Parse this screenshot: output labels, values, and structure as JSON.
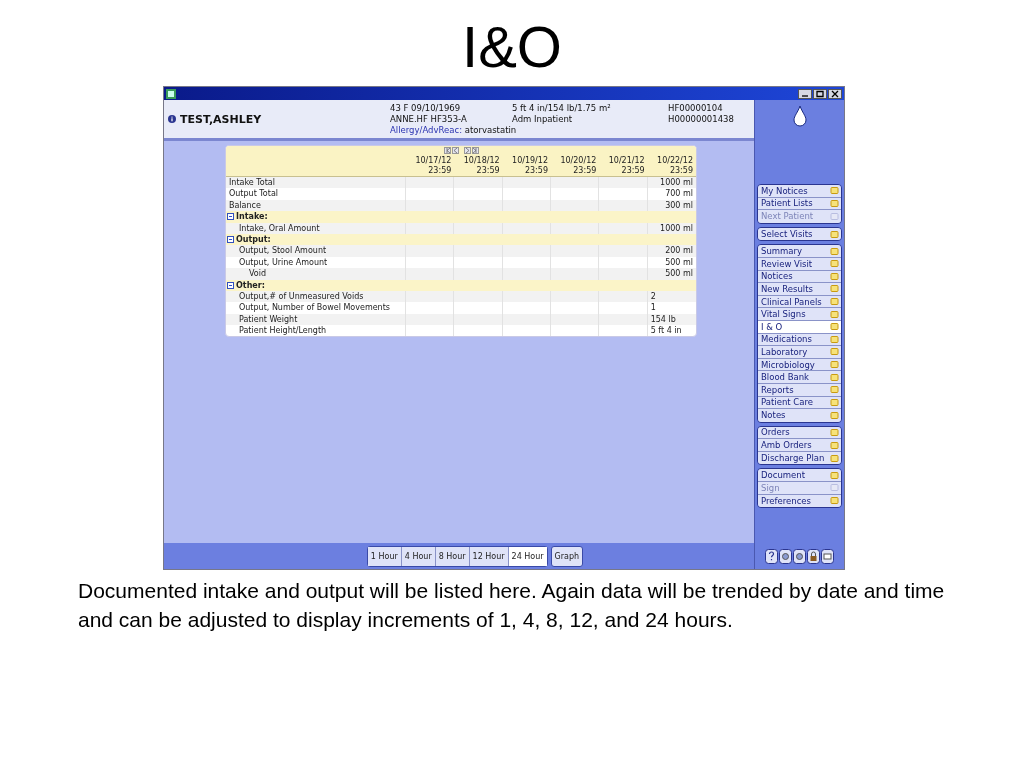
{
  "slide": {
    "title": "I&O",
    "caption": "Documented intake and output will be listed here. Again data will be trended by date and time and can be adjusted to display increments of 1, 4, 8, 12, and 24 hours."
  },
  "header": {
    "patient_name": "TEST,ASHLEY",
    "info_columns": [
      [
        "43 F 09/10/1969",
        "ANNE.HF HF353-A"
      ],
      [
        "5 ft 4 in/154 lb/1.75 m²",
        "Adm Inpatient"
      ],
      [
        "HF00000104",
        "H00000001438"
      ]
    ],
    "allergy_label": "Allergy/AdvReac:",
    "allergy_value": "atorvastatin"
  },
  "table": {
    "columns": [
      {
        "date": "10/17/12",
        "time": "23:59"
      },
      {
        "date": "10/18/12",
        "time": "23:59"
      },
      {
        "date": "10/19/12",
        "time": "23:59"
      },
      {
        "date": "10/20/12",
        "time": "23:59"
      },
      {
        "date": "10/21/12",
        "time": "23:59"
      },
      {
        "date": "10/22/12",
        "time": "23:59"
      }
    ],
    "rows": [
      {
        "kind": "row",
        "label": "Intake Total",
        "latest_value": "1000 ml"
      },
      {
        "kind": "row",
        "label": "Output Total",
        "latest_value": "700 ml"
      },
      {
        "kind": "row",
        "label": "Balance",
        "latest_value": "300 ml"
      },
      {
        "kind": "section",
        "label": "Intake:",
        "expanded": true,
        "children": [
          {
            "kind": "row",
            "label": "Intake, Oral Amount",
            "latest_value": "1000 ml"
          }
        ]
      },
      {
        "kind": "section",
        "label": "Output:",
        "expanded": true,
        "children": [
          {
            "kind": "row",
            "label": "Output, Stool Amount",
            "latest_value": "200 ml"
          },
          {
            "kind": "row",
            "label": "Output, Urine Amount",
            "latest_value": "500 ml",
            "children": [
              {
                "kind": "row",
                "label": "Void",
                "latest_value": "500 ml"
              }
            ]
          }
        ]
      },
      {
        "kind": "section",
        "label": "Other:",
        "expanded": true,
        "children": [
          {
            "kind": "text",
            "label": "Output,# of Unmeasured Voids",
            "latest_value": "2"
          },
          {
            "kind": "text",
            "label": "Output, Number of Bowel Movements",
            "latest_value": "1"
          },
          {
            "kind": "text",
            "label": "Patient Weight",
            "latest_value": "154 lb"
          },
          {
            "kind": "text",
            "label": "Patient Height/Length",
            "latest_value": "5 ft 4 in"
          }
        ]
      }
    ]
  },
  "interval_tabs": [
    {
      "label": "1 Hour",
      "selected": false
    },
    {
      "label": "4 Hour",
      "selected": false
    },
    {
      "label": "8 Hour",
      "selected": false
    },
    {
      "label": "12 Hour",
      "selected": false
    },
    {
      "label": "24 Hour",
      "selected": true
    }
  ],
  "graph_button": "Graph",
  "sidebar": {
    "groups": [
      {
        "items": [
          {
            "label": "My Notices",
            "disabled": false,
            "selected": false
          },
          {
            "label": "Patient Lists",
            "disabled": false,
            "selected": false
          },
          {
            "label": "Next Patient",
            "disabled": true,
            "selected": false
          }
        ]
      },
      {
        "items": [
          {
            "label": "Select Visits",
            "disabled": false,
            "selected": false
          }
        ]
      },
      {
        "items": [
          {
            "label": "Summary",
            "disabled": false,
            "selected": false
          },
          {
            "label": "Review Visit",
            "disabled": false,
            "selected": false
          },
          {
            "label": "Notices",
            "disabled": false,
            "selected": false
          },
          {
            "label": "New Results",
            "disabled": false,
            "selected": false
          },
          {
            "label": "Clinical Panels",
            "disabled": false,
            "selected": false
          },
          {
            "label": "Vital Signs",
            "disabled": false,
            "selected": false
          },
          {
            "label": "I & O",
            "disabled": false,
            "selected": true
          },
          {
            "label": "Medications",
            "disabled": false,
            "selected": false
          },
          {
            "label": "Laboratory",
            "disabled": false,
            "selected": false
          },
          {
            "label": "Microbiology",
            "disabled": false,
            "selected": false
          },
          {
            "label": "Blood Bank",
            "disabled": false,
            "selected": false
          },
          {
            "label": "Reports",
            "disabled": false,
            "selected": false
          },
          {
            "label": "Patient Care",
            "disabled": false,
            "selected": false
          },
          {
            "label": "Notes",
            "disabled": false,
            "selected": false
          }
        ]
      },
      {
        "items": [
          {
            "label": "Orders",
            "disabled": false,
            "selected": false
          },
          {
            "label": "Amb Orders",
            "disabled": false,
            "selected": false
          },
          {
            "label": "Discharge Plan",
            "disabled": false,
            "selected": false
          }
        ]
      },
      {
        "items": [
          {
            "label": "Document",
            "disabled": false,
            "selected": false
          },
          {
            "label": "Sign",
            "disabled": true,
            "selected": false
          },
          {
            "label": "Preferences",
            "disabled": false,
            "selected": false
          }
        ]
      }
    ]
  }
}
